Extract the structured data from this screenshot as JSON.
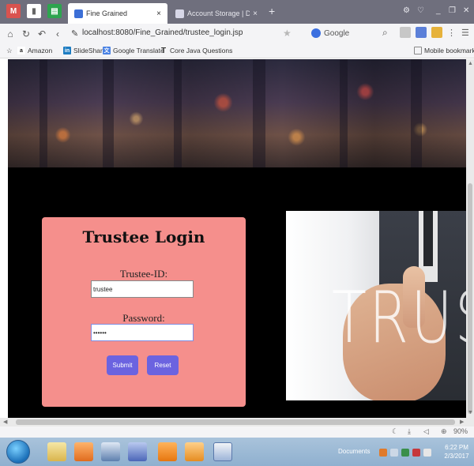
{
  "browser": {
    "tabs": [
      {
        "title": "Fine Grained",
        "active": true,
        "close_glyph": "×"
      },
      {
        "title": "Account Storage | DriveHQ",
        "active": false,
        "close_glyph": "×"
      }
    ],
    "new_tab_glyph": "+",
    "url": "localhost:8080/Fine_Grained/trustee_login.jsp",
    "search_engine": "Google",
    "bookmarks": [
      "Amazon",
      "SlideShare",
      "Google Translate",
      "Core Java Questions"
    ],
    "mobile_bookmarks": "Mobile bookmarks",
    "zoom": "90%"
  },
  "login": {
    "title": "Trustee Login",
    "trustee_id_label": "Trustee-ID:",
    "trustee_id_value": "trustee",
    "password_label": "Password:",
    "password_value": "••••••",
    "submit_label": "Submit",
    "reset_label": "Reset",
    "panel_color": "#f58f8c",
    "button_color": "#6b63e0"
  },
  "image": {
    "overlay_text": "TRUS"
  },
  "taskbar": {
    "documents_label": "Documents",
    "time": "6:22 PM",
    "date": "2/3/2017"
  }
}
